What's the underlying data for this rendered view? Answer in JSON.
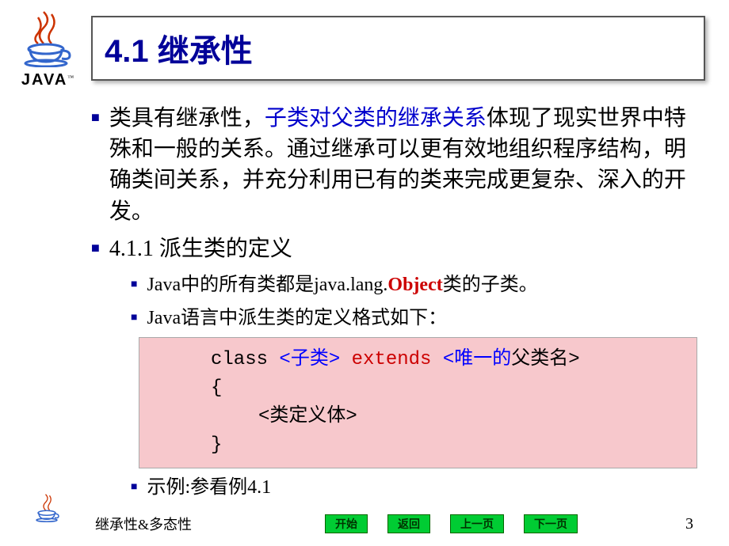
{
  "logo": {
    "text": "JAVA",
    "tm": "™"
  },
  "title": "4.1 继承性",
  "bullets": {
    "b1_part1": "类具有继承性，",
    "b1_blue": "子类对父类的继承关系",
    "b1_part2": "体现了现实世界中特殊和一般的关系。通过继承可以更有效地组织程序结构，明确类间关系，并充分利用已有的类来完成更复杂、深入的开发。",
    "b2": "4.1.1 派生类的定义",
    "s1_part1": "Java中的所有类都是java.lang.",
    "s1_red": "Object",
    "s1_part2": "类的子类。",
    "s2": "Java语言中派生类的定义格式如下：",
    "s3": "示例:参看例4.1"
  },
  "code": {
    "kw_class": "class ",
    "sub": "<子类>",
    "extends": " extends ",
    "parent_blue": "<唯一的",
    "parent_black": "父类名>",
    "brace_open": "{",
    "body": "<类定义体>",
    "brace_close": "}"
  },
  "footer": {
    "title": "继承性&多态性",
    "page": "3"
  },
  "nav": {
    "start": "开始",
    "back": "返回",
    "prev": "上一页",
    "next": "下一页"
  }
}
